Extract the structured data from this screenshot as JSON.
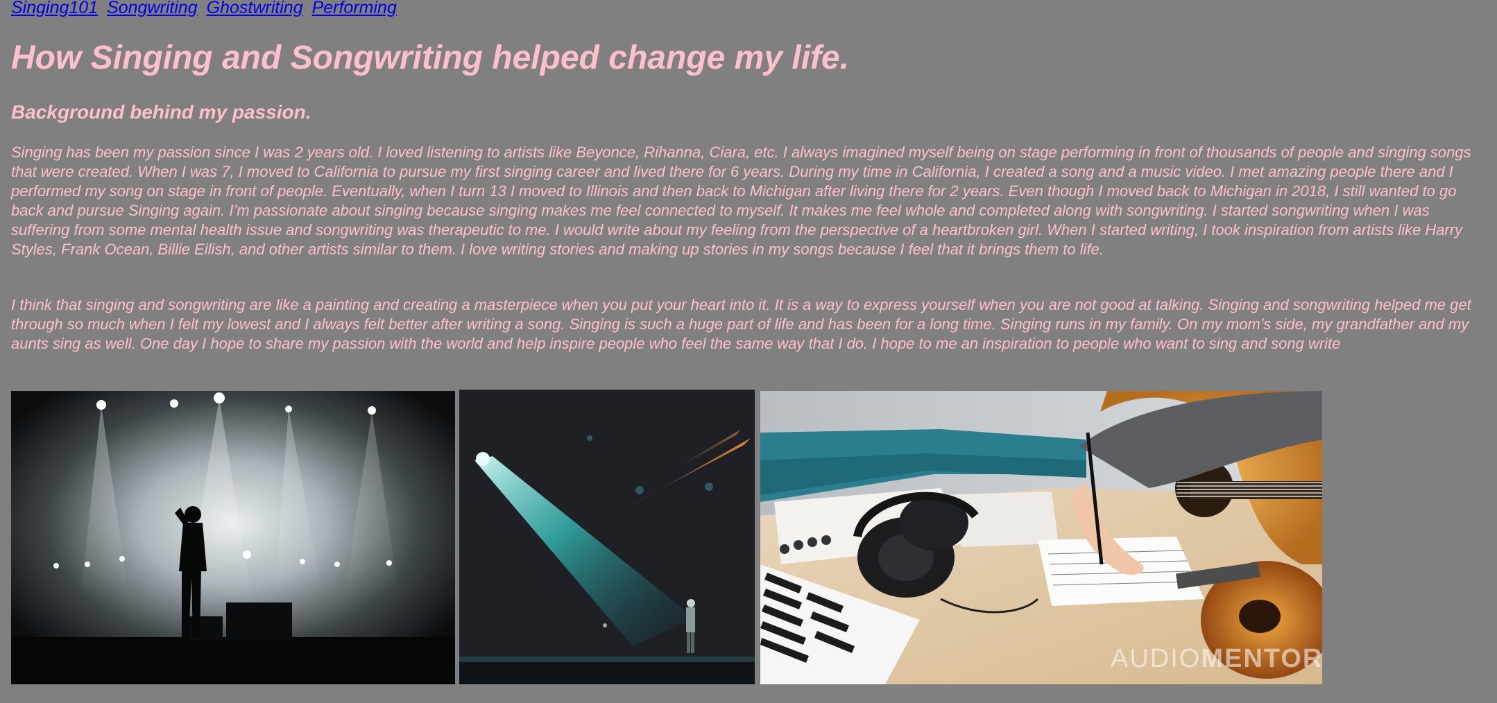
{
  "nav": {
    "links": [
      "Singing101",
      "Songwriting",
      "Ghostwriting",
      "Performing"
    ]
  },
  "heading": "How Singing and Songwriting helped change my life.",
  "subheading": "Background behind my passion.",
  "paragraphs": [
    "Singing has been my passion since I was 2 years old. I loved listening to artists like Beyonce, Rihanna, Ciara, etc. I always imagined myself being on stage performing in front of thousands of people and singing songs that were created. When I was 7, I moved to California to pursue my first singing career and lived there for 6 years. During my time in California, I created a song and a music video. I met amazing people there and I performed my song on stage in front of people. Eventually, when I turn 13 I moved to Illinois and then back to Michigan after living there for 2 years. Even though I moved back to Michigan in 2018, I still wanted to go back and pursue Singing again. I’m passionate about singing because singing makes me feel connected to myself. It makes me feel whole and completed along with songwriting. I started songwriting when I was suffering from some mental health issue and songwriting was therapeutic to me. I would write about my feeling from the perspective of a heartbroken girl. When I started writing, I took inspiration from artists like Harry Styles, Frank Ocean, Billie Eilish, and other artists similar to them. I love writing stories and making up stories in my songs because I feel that it brings them to life.",
    "I think that singing and songwriting are like a painting and creating a masterpiece when you put your heart into it. It is a way to express yourself when you are not good at talking. Singing and songwriting helped me get through so much when I felt my lowest and I always felt better after writing a song. Singing is such a huge part of life and has been for a long time. Singing runs in my family. On my mom’s side, my grandfather and my aunts sing as well. One day I hope to share my passion with the world and help inspire people who feel the same way that I do. I hope to me an inspiration to people who want to sing and song write"
  ],
  "images": {
    "watermark_light": "AUDIO",
    "watermark_bold": "MENTOR"
  },
  "colors": {
    "background": "#808080",
    "text": "#ffc0cb",
    "link": "#0000ee"
  }
}
